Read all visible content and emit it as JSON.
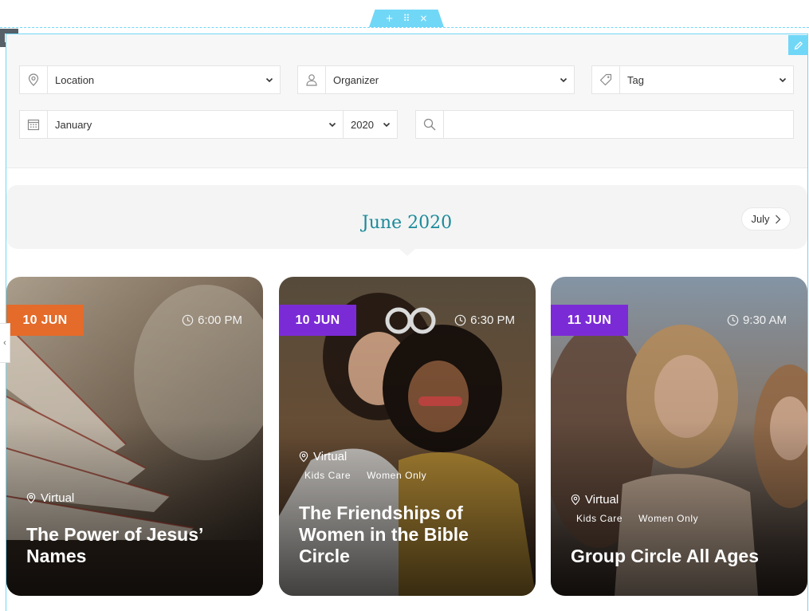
{
  "editor": {
    "add_symbol": "+",
    "drag_symbol": "⠿",
    "close_symbol": "×",
    "side_toggle_symbol": "‹"
  },
  "filters": {
    "location": "Location",
    "organizer": "Organizer",
    "tag": "Tag",
    "month": "January",
    "year": "2020",
    "search_value": ""
  },
  "calendar": {
    "current_month": "June 2020",
    "next_month": "July"
  },
  "colors": {
    "accent_teal": "#1a8a9a",
    "badge_orange": "#e46b2a",
    "badge_purple": "#7b2bd6",
    "editor_cyan": "#71d7f7"
  },
  "events": [
    {
      "date": "10 JUN",
      "time": "6:00 PM",
      "location": "Virtual",
      "tags": [],
      "title_lines": [
        "The Power of Jesus’",
        "Names"
      ],
      "badge_color": "orange"
    },
    {
      "date": "10 JUN",
      "time": "6:30 PM",
      "location": "Virtual",
      "tags": [
        "Kids Care",
        "Women Only"
      ],
      "title_lines": [
        "The Friendships of",
        "Women in the Bible",
        "Circle"
      ],
      "badge_color": "purple"
    },
    {
      "date": "11 JUN",
      "time": "9:30 AM",
      "location": "Virtual",
      "tags": [
        "Kids Care",
        "Women Only"
      ],
      "title_lines": [
        "Group Circle All Ages"
      ],
      "badge_color": "purple"
    }
  ]
}
